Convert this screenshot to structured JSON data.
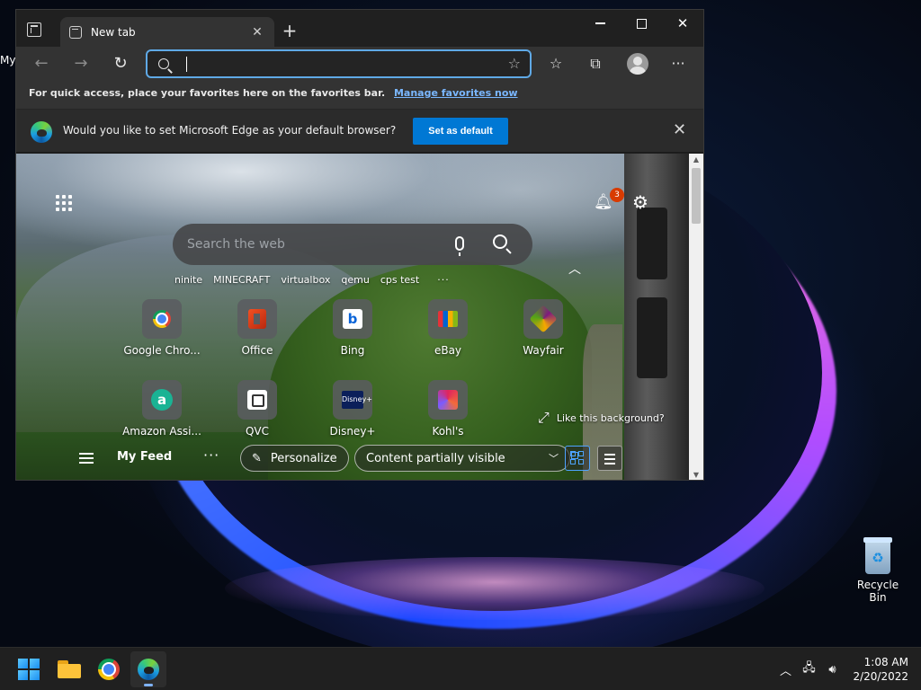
{
  "desktop": {
    "stub_label": "My",
    "recycle_bin_label": "Recycle Bin"
  },
  "browser": {
    "tab_title": "New tab",
    "address_value": "",
    "favorites_bar_text": "For quick access, place your favorites here on the favorites bar.",
    "favorites_bar_link": "Manage favorites now",
    "infobar_message": "Would you like to set Microsoft Edge as your default browser?",
    "infobar_button": "Set as default"
  },
  "newtab": {
    "search_placeholder": "Search the web",
    "notification_count": "3",
    "quick_links": [
      "ninite",
      "MINECRAFT",
      "virtualbox",
      "qemu",
      "cps test"
    ],
    "quick_links_more": "···",
    "tiles": [
      {
        "label": "Google Chro...",
        "icon": "chrome-icon"
      },
      {
        "label": "Office",
        "icon": "office-icon"
      },
      {
        "label": "Bing",
        "icon": "bing-icon"
      },
      {
        "label": "eBay",
        "icon": "ebay-icon"
      },
      {
        "label": "Wayfair",
        "icon": "wayfair-icon"
      },
      {
        "label": "Amazon Assi...",
        "icon": "amazon-assistant-icon"
      },
      {
        "label": "QVC",
        "icon": "qvc-icon"
      },
      {
        "label": "Disney+",
        "icon": "disney-plus-icon"
      },
      {
        "label": "Kohl's",
        "icon": "kohls-icon"
      }
    ],
    "bing_letter": "b",
    "amazon_letter": "a",
    "disney_text": "Disney+",
    "like_background": "Like this background?",
    "feed_label": "My Feed",
    "feed_more": "···",
    "personalize": "Personalize",
    "content_visibility": "Content partially visible"
  },
  "taskbar": {
    "time": "1:08 AM",
    "date": "2/20/2022",
    "apps": [
      "start-icon",
      "file-explorer-icon",
      "chrome-icon",
      "edge-icon"
    ]
  },
  "colors": {
    "accent": "#0078d4",
    "link": "#7ab7ff",
    "badge": "#d83b01",
    "address_focus": "#5fa9e6"
  }
}
